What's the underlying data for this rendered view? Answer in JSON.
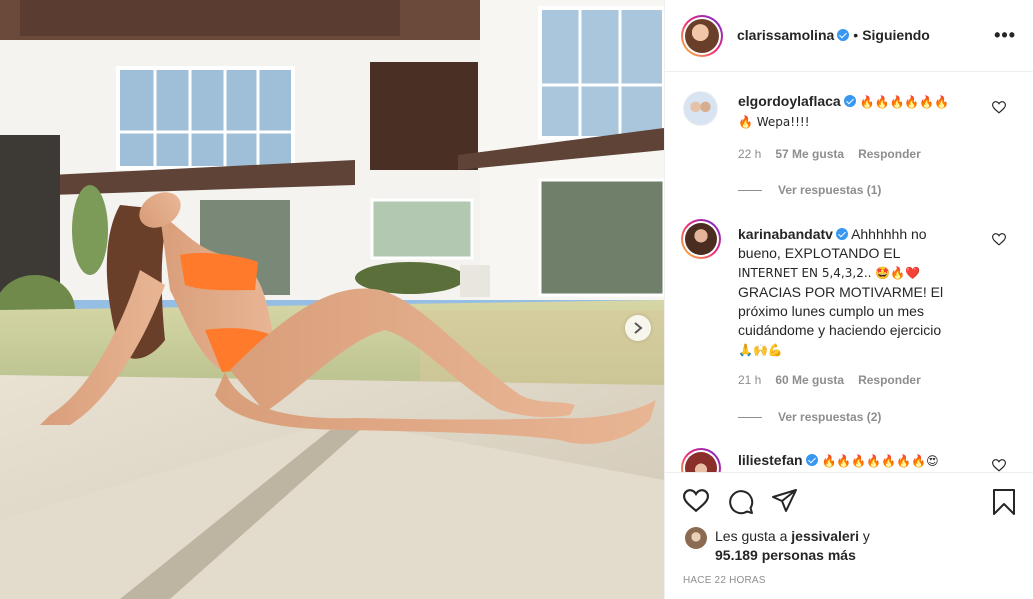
{
  "post": {
    "author": "clarissamolina",
    "verified": true,
    "separator": "•",
    "follow_status": "Siguiendo",
    "more_icon": "more-horizontal-icon",
    "more_glyph": "•••"
  },
  "comments": [
    {
      "username": "elgordoylaflaca",
      "verified": true,
      "text_lines": [
        "🔥🔥🔥🔥🔥🔥",
        "🔥 Wepa!!!!"
      ],
      "time": "22 h",
      "likes": "57 Me gusta",
      "reply": "Responder",
      "view_replies": "Ver respuestas (1)"
    },
    {
      "username": "karinabandatv",
      "verified": true,
      "text_lines": [
        "Ahhhhhh no",
        "bueno, EXPLOTANDO EL",
        "INTERNET EN 5,4,3,2.. 🤩🔥❤️",
        "GRACIAS POR MOTIVARME! El",
        "próximo lunes cumplo un mes",
        "cuidándome y haciendo ejercicio",
        "🙏🙌💪"
      ],
      "time": "21 h",
      "likes": "60 Me gusta",
      "reply": "Responder",
      "view_replies": "Ver respuestas (2)"
    },
    {
      "username": "liliestefan",
      "verified": true,
      "text_lines": [
        "🔥🔥🔥🔥🔥🔥🔥😍"
      ]
    }
  ],
  "likes": {
    "prefix": "Les gusta a",
    "liker": "jessivaleri",
    "conjunction": "y",
    "count": "95.189 personas más"
  },
  "timestamp": "HACE 22 HORAS",
  "colors": {
    "accent_blue": "#3897f0",
    "text": "#262626",
    "secondary": "#8e8e8e",
    "bikini": "#ff7a2a"
  }
}
